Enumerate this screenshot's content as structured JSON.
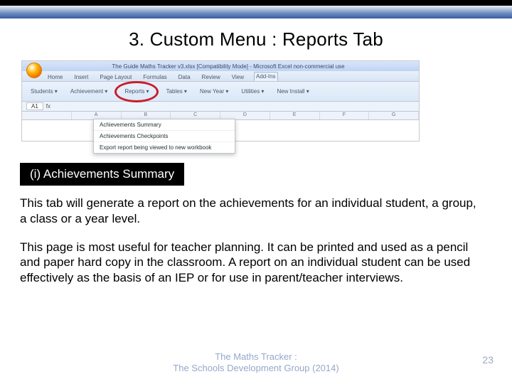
{
  "slide": {
    "title": "3.  Custom Menu :  Reports Tab",
    "section_label": "(i)  Achievements Summary",
    "para1": "This tab will generate a report on the achievements for an individual student, a group, a class or a year level.",
    "para2": "This page is most useful for teacher planning.  It can be printed and used as a pencil and paper hard copy in the classroom.   A report on an individual student can be used effectively as the basis of an IEP or for use in parent/teacher interviews.",
    "footer_line1": "The Maths Tracker :",
    "footer_line2": "The Schools Development Group  (2014)",
    "page_number": "23"
  },
  "excel": {
    "window_title": "The Guide Maths Tracker v3.xlsx  [Compatibility Mode] - Microsoft Excel non-commercial use",
    "tabs": [
      "Home",
      "Insert",
      "Page Layout",
      "Formulas",
      "Data",
      "Review",
      "View",
      "Add-Ins"
    ],
    "active_tab": "Add-Ins",
    "ribbon_groups": [
      "Students ▾",
      "Achievement ▾",
      "Reports ▾",
      "Tables ▾",
      "New Year ▾",
      "Utilities ▾",
      "New Install ▾"
    ],
    "highlighted_group": "Reports ▾",
    "dropdown_items": [
      "Achievements Summary",
      "Achievements Checkpoints",
      "Export report being viewed to new workbook"
    ],
    "name_box": "A1",
    "columns": [
      "",
      "A",
      "B",
      "C",
      "D",
      "E",
      "F",
      "G"
    ]
  }
}
